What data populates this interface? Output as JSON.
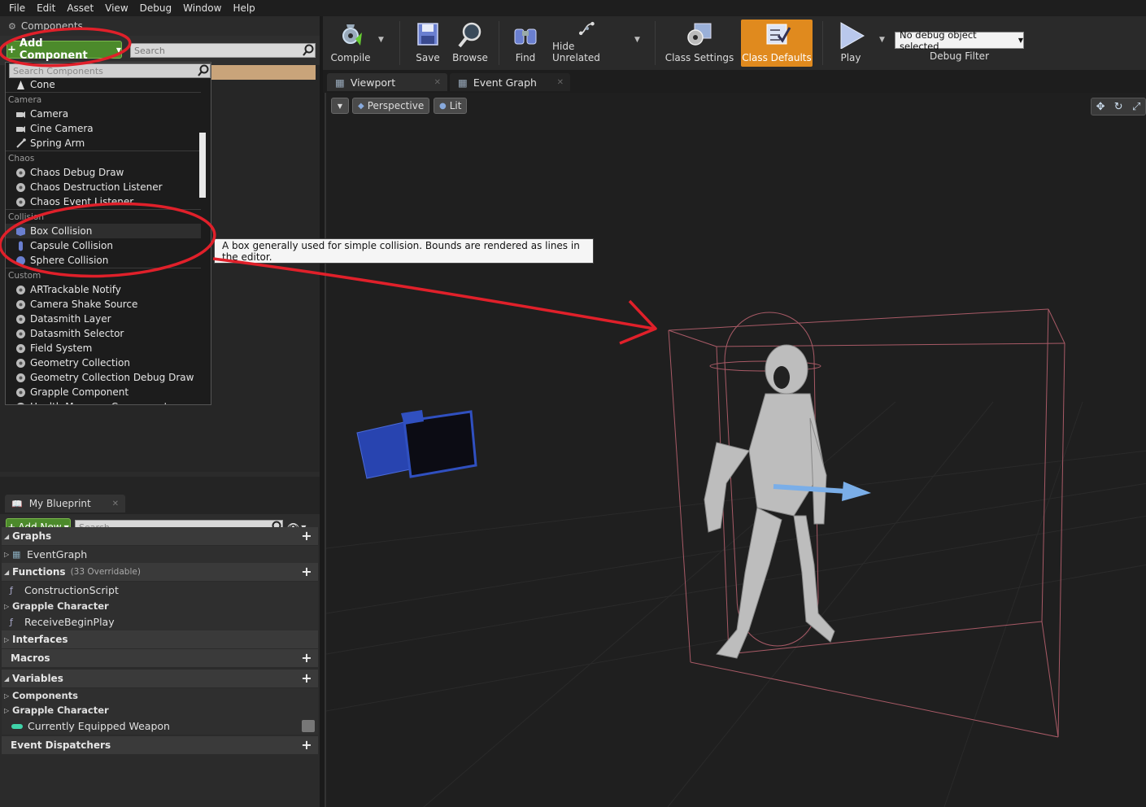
{
  "menu": [
    "File",
    "Edit",
    "Asset",
    "View",
    "Debug",
    "Window",
    "Help"
  ],
  "components_panel": {
    "tab_label": "Components",
    "add_component_label": "Add Component",
    "search_placeholder": "Search",
    "dropdown_search_placeholder": "Search Components",
    "items": [
      {
        "type": "item",
        "label": "Cone",
        "icon": "cone-icon"
      },
      {
        "type": "category",
        "label": "Camera"
      },
      {
        "type": "item",
        "label": "Camera",
        "icon": "camera-icon"
      },
      {
        "type": "item",
        "label": "Cine Camera",
        "icon": "camera-icon"
      },
      {
        "type": "item",
        "label": "Spring Arm",
        "icon": "spring-arm-icon"
      },
      {
        "type": "category",
        "label": "Chaos"
      },
      {
        "type": "item",
        "label": "Chaos Debug Draw",
        "icon": "component-icon"
      },
      {
        "type": "item",
        "label": "Chaos Destruction Listener",
        "icon": "component-icon"
      },
      {
        "type": "item",
        "label": "Chaos Event Listener",
        "icon": "component-icon"
      },
      {
        "type": "category",
        "label": "Collision"
      },
      {
        "type": "item",
        "label": "Box Collision",
        "icon": "box-collision-icon",
        "highlighted": true
      },
      {
        "type": "item",
        "label": "Capsule Collision",
        "icon": "capsule-icon"
      },
      {
        "type": "item",
        "label": "Sphere Collision",
        "icon": "sphere-icon"
      },
      {
        "type": "category",
        "label": "Custom"
      },
      {
        "type": "item",
        "label": "ARTrackable Notify",
        "icon": "component-icon"
      },
      {
        "type": "item",
        "label": "Camera Shake Source",
        "icon": "component-icon"
      },
      {
        "type": "item",
        "label": "Datasmith Layer",
        "icon": "component-icon"
      },
      {
        "type": "item",
        "label": "Datasmith Selector",
        "icon": "component-icon"
      },
      {
        "type": "item",
        "label": "Field System",
        "icon": "component-icon"
      },
      {
        "type": "item",
        "label": "Geometry Collection",
        "icon": "component-icon"
      },
      {
        "type": "item",
        "label": "Geometry Collection Debug Draw",
        "icon": "component-icon"
      },
      {
        "type": "item",
        "label": "Grapple Component",
        "icon": "component-icon"
      },
      {
        "type": "item",
        "label": "Health Manager Component",
        "icon": "component-icon"
      }
    ],
    "tooltip": "A box generally used for simple collision. Bounds are rendered as lines in the editor."
  },
  "my_blueprint": {
    "tab_label": "My Blueprint",
    "add_new_label": "Add New",
    "search_placeholder": "Search",
    "graphs_label": "Graphs",
    "event_graph_label": "EventGraph",
    "functions_label": "Functions",
    "functions_sub": "(33 Overridable)",
    "construction_script_label": "ConstructionScript",
    "grapple_character_label": "Grapple Character",
    "receive_begin_play_label": "ReceiveBeginPlay",
    "interfaces_label": "Interfaces",
    "macros_label": "Macros",
    "variables_label": "Variables",
    "components_label": "Components",
    "grapple_character_label_2": "Grapple Character",
    "currently_equipped_label": "Currently Equipped Weapon",
    "event_dispatchers_label": "Event Dispatchers"
  },
  "toolbar": {
    "compile": "Compile",
    "save": "Save",
    "browse": "Browse",
    "find": "Find",
    "hide_unrelated": "Hide Unrelated",
    "class_settings": "Class Settings",
    "class_defaults": "Class Defaults",
    "play": "Play",
    "debug_select": "No debug object selected",
    "debug_filter": "Debug Filter"
  },
  "editor_tabs": {
    "viewport": "Viewport",
    "event_graph": "Event Graph"
  },
  "viewport": {
    "perspective": "Perspective",
    "lit": "Lit"
  },
  "colors": {
    "accent_green": "#4c8a2b",
    "active_orange": "#e08a1e",
    "annotation_red": "#e0202a",
    "variable_teal": "#3fd3a8"
  }
}
